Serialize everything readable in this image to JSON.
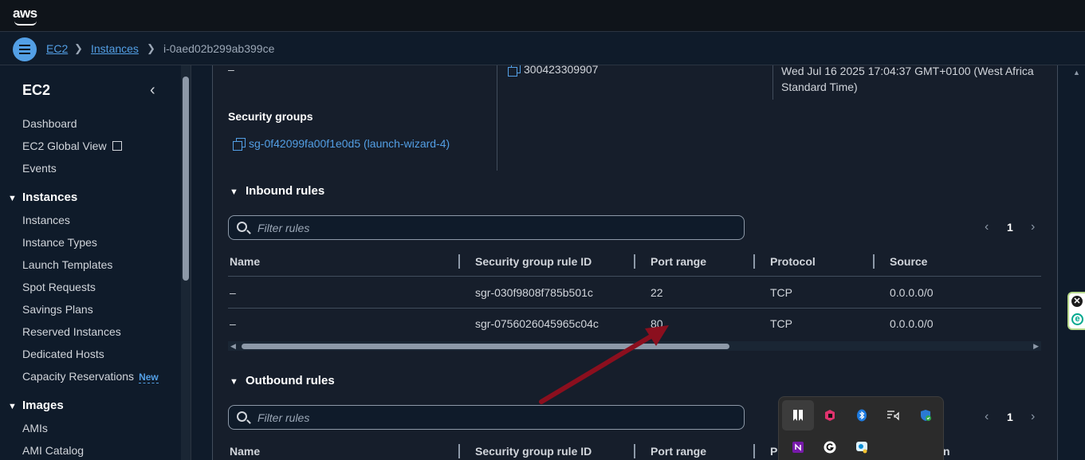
{
  "topbar": {
    "logo": "aws"
  },
  "breadcrumb": {
    "items": [
      "EC2",
      "Instances"
    ],
    "current": "i-0aed02b299ab399ce"
  },
  "sidebar": {
    "title": "EC2",
    "items_top": [
      "Dashboard",
      "EC2 Global View",
      "Events"
    ],
    "sections": [
      {
        "title": "Instances",
        "items": [
          "Instances",
          "Instance Types",
          "Launch Templates",
          "Spot Requests",
          "Savings Plans",
          "Reserved Instances",
          "Dedicated Hosts",
          "Capacity Reservations"
        ]
      },
      {
        "title": "Images",
        "items": [
          "AMIs",
          "AMI Catalog"
        ]
      }
    ],
    "new_badge": "New"
  },
  "details": {
    "dash": "–",
    "owner_id": "300423309907",
    "launch_time": "Wed Jul 16 2025 17:04:37 GMT+0100 (West Africa Standard Time)",
    "security_groups_label": "Security groups",
    "security_group_link": "sg-0f42099fa00f1e0d5 (launch-wizard-4)"
  },
  "inbound": {
    "title": "Inbound rules",
    "filter_placeholder": "Filter rules",
    "page": "1",
    "columns": [
      "Name",
      "Security group rule ID",
      "Port range",
      "Protocol",
      "Source"
    ],
    "rows": [
      {
        "name": "–",
        "rule_id": "sgr-030f9808f785b501c",
        "port": "22",
        "protocol": "TCP",
        "source": "0.0.0.0/0"
      },
      {
        "name": "–",
        "rule_id": "sgr-0756026045965c04c",
        "port": "80",
        "protocol": "TCP",
        "source": "0.0.0.0/0"
      }
    ]
  },
  "outbound": {
    "title": "Outbound rules",
    "filter_placeholder": "Filter rules",
    "page": "1",
    "columns": [
      "Name",
      "Security group rule ID",
      "Port range",
      "P",
      "n"
    ]
  },
  "annotation": {
    "arrow_color": "#8b0f1e"
  },
  "colors": {
    "link": "#539fe5",
    "background": "#0f1b2a",
    "panel": "#161e2b"
  },
  "extension": {
    "close": "✕",
    "logo": "e"
  },
  "tray_icons": [
    "tray-app-icon",
    "jetbrains-icon",
    "bluetooth-icon",
    "audio-device-icon",
    "security-shield-icon",
    "onenote-icon",
    "grammarly-icon",
    "chat-app-icon"
  ]
}
